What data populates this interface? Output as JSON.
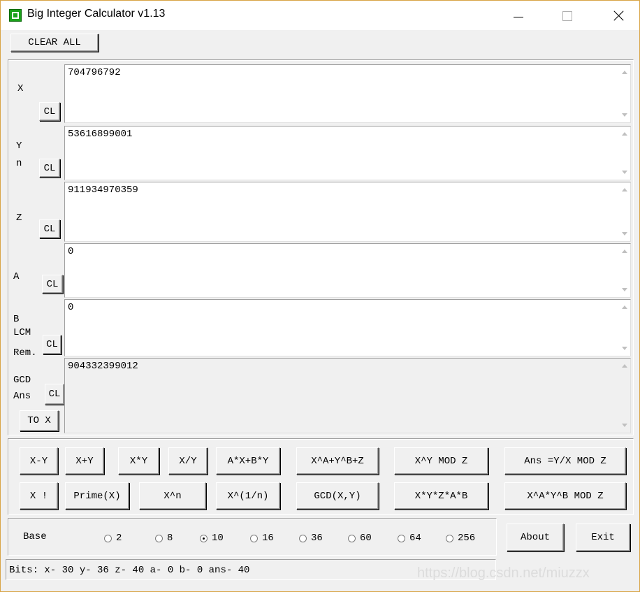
{
  "window": {
    "title": "Big Integer Calculator v1.13"
  },
  "toolbar": {
    "clear_all": "CLEAR ALL"
  },
  "fields": [
    {
      "id": "x",
      "labels": [
        "X"
      ],
      "clear_label": "CL",
      "value": "704796792"
    },
    {
      "id": "y",
      "labels": [
        "Y",
        "n"
      ],
      "clear_label": "CL",
      "value": "53616899001"
    },
    {
      "id": "z",
      "labels": [
        "Z"
      ],
      "clear_label": "CL",
      "value": "911934970359"
    },
    {
      "id": "a",
      "labels": [
        "A"
      ],
      "clear_label": "CL",
      "value": "0"
    },
    {
      "id": "b",
      "labels": [
        "B",
        "LCM",
        "Rem."
      ],
      "clear_label": "CL",
      "value": "0"
    },
    {
      "id": "ans",
      "labels": [
        "GCD",
        "Ans"
      ],
      "clear_label": "CL",
      "to_x_label": "TO X",
      "value": "904332399012"
    }
  ],
  "ops_row1": [
    "X-Y",
    "X+Y",
    "X*Y",
    "X/Y",
    "A*X+B*Y",
    "X^A+Y^B+Z",
    "X^Y MOD Z",
    "Ans =Y/X MOD Z"
  ],
  "ops_row2": [
    "X !",
    "Prime(X)",
    "X^n",
    "X^(1/n)",
    "GCD(X,Y)",
    "X*Y*Z*A*B",
    "X^A*Y^B MOD Z"
  ],
  "base": {
    "label": "Base",
    "options": [
      "2",
      "8",
      "10",
      "16",
      "36",
      "60",
      "64",
      "256"
    ],
    "selected": "10"
  },
  "buttons": {
    "about": "About",
    "exit": "Exit"
  },
  "status": "Bits: x- 30 y- 36 z- 40 a- 0 b- 0 ans- 40",
  "watermark": "https://blog.csdn.net/miuzzx",
  "icons": {
    "app": "app-icon",
    "minimize": "minimize-icon",
    "maximize": "maximize-icon",
    "close": "close-icon"
  }
}
